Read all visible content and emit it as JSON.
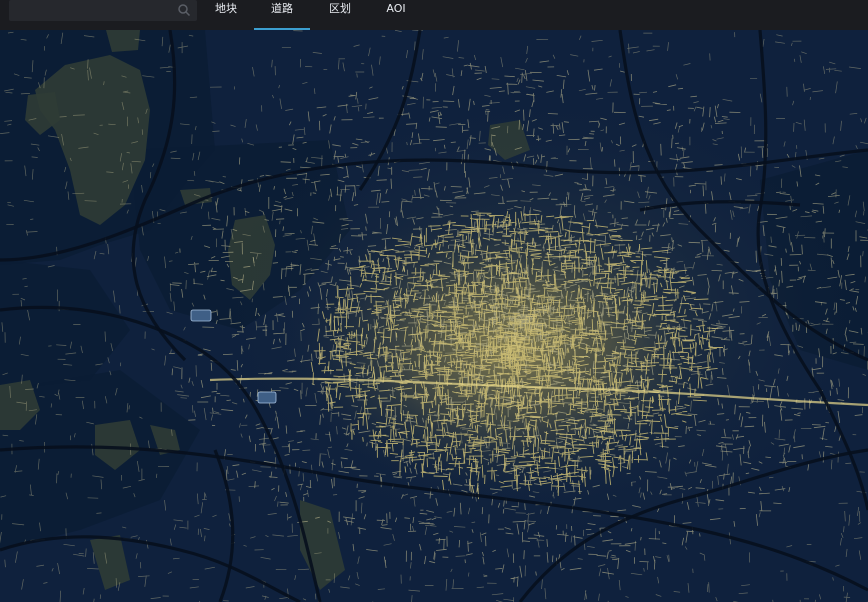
{
  "search": {
    "placeholder": "",
    "icon": "search-icon"
  },
  "tabs": [
    {
      "label": "地块",
      "active": false
    },
    {
      "label": "道路",
      "active": true
    },
    {
      "label": "区划",
      "active": false
    },
    {
      "label": "AOI",
      "active": false
    }
  ],
  "colors": {
    "topbar": "#1b1c20",
    "map_background": "#0f213d",
    "water": "#0b1c34",
    "green_area": "#2f3c35",
    "road_dense": "#d7c778",
    "road_sparse": "#c8c295",
    "highway": "#07101d",
    "tab_underline": "#3c9fd0"
  }
}
